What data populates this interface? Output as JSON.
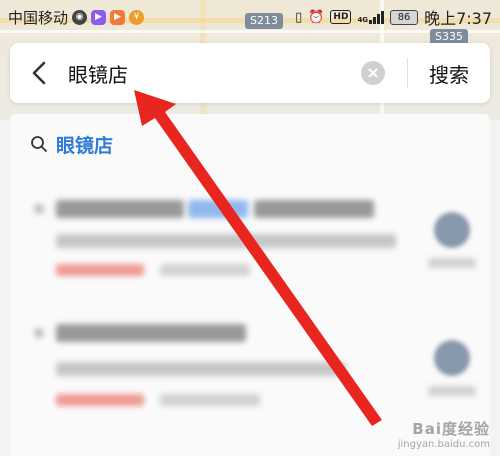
{
  "status_bar": {
    "carrier": "中国移动",
    "battery": "86",
    "time": "晚上7:37",
    "network_label": "4G",
    "hd_label": "HD"
  },
  "map": {
    "road_shield_1": "S213",
    "road_shield_2": "S335"
  },
  "search": {
    "query": "眼镜店",
    "button_label": "搜索"
  },
  "suggestion": {
    "text": "眼镜店"
  },
  "watermark": {
    "main": "Bai度经验",
    "url": "jingyan.baidu.com"
  },
  "colors": {
    "accent_blue": "#2f7bd8",
    "arrow_red": "#e8251f"
  }
}
